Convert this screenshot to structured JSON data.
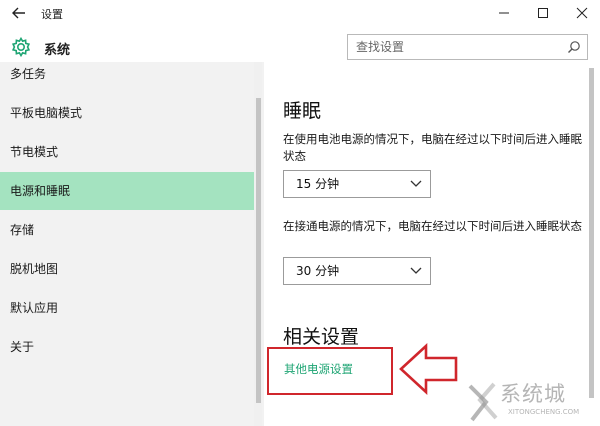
{
  "window": {
    "title": "设置",
    "controls": [
      "minimize",
      "maximize",
      "close"
    ]
  },
  "header": {
    "app_title": "系统",
    "search_placeholder": "查找设置"
  },
  "sidebar": {
    "items": [
      {
        "label": "多任务"
      },
      {
        "label": "平板电脑模式"
      },
      {
        "label": "节电模式"
      },
      {
        "label": "电源和睡眠",
        "active": true
      },
      {
        "label": "存储"
      },
      {
        "label": "脱机地图"
      },
      {
        "label": "默认应用"
      },
      {
        "label": "关于"
      }
    ]
  },
  "main": {
    "sleep": {
      "heading": "睡眠",
      "battery_desc": "在使用电池电源的情况下，电脑在经过以下时间后进入睡眠状态",
      "battery_value": "15 分钟",
      "plugged_desc": "在接通电源的情况下，电脑在经过以下时间后进入睡眠状态",
      "plugged_value": "30 分钟"
    },
    "related": {
      "heading": "相关设置",
      "link": "其他电源设置"
    }
  },
  "watermark": {
    "text": "系统城",
    "sub": "XITONGCHENG.COM"
  },
  "colors": {
    "accent_green": "#1fa574",
    "active_item": "#a4e3c0",
    "annotation_red": "#d0262c",
    "sidebar_bg": "#f2f2f2"
  },
  "icons": [
    "back-arrow-icon",
    "minimize-icon",
    "maximize-icon",
    "close-icon",
    "gear-icon",
    "search-icon",
    "chevron-down-icon",
    "pointer-arrow-icon"
  ]
}
